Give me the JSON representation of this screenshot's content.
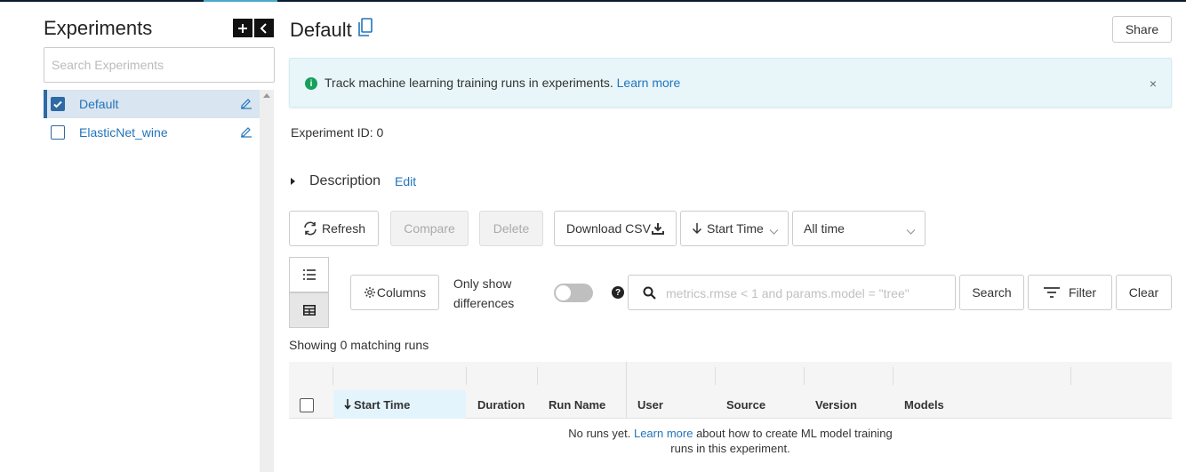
{
  "sidebar": {
    "title": "Experiments",
    "search_placeholder": "Search Experiments",
    "items": [
      {
        "name": "Default",
        "selected": true
      },
      {
        "name": "ElasticNet_wine",
        "selected": false
      }
    ]
  },
  "header": {
    "title": "Default",
    "share_label": "Share"
  },
  "banner": {
    "message": "Track machine learning training runs in experiments.",
    "link": "Learn more",
    "close": "×"
  },
  "experiment": {
    "id_label": "Experiment ID:",
    "id_value": "0"
  },
  "description": {
    "label": "Description",
    "edit_label": "Edit"
  },
  "toolbar": {
    "refresh": "Refresh",
    "compare": "Compare",
    "delete": "Delete",
    "download": "Download CSV",
    "sort_label": "Start Time",
    "time_filter": "All time"
  },
  "controls": {
    "columns": "Columns",
    "only_show_line1": "Only show",
    "only_show_line2": "differences",
    "search_placeholder": "metrics.rmse < 1 and params.model = \"tree\"",
    "search_button": "Search",
    "filter_button": "Filter",
    "clear_button": "Clear"
  },
  "runs": {
    "showing": "Showing 0 matching runs",
    "columns": [
      "Start Time",
      "Duration",
      "Run Name",
      "User",
      "Source",
      "Version",
      "Models"
    ],
    "empty_prefix": "No runs yet.",
    "empty_link": "Learn more",
    "empty_line1_suffix": "about how to create ML model training",
    "empty_line2": "runs in this experiment."
  },
  "colors": {
    "accent": "#2374bb",
    "selected_bg": "#d9e5f0",
    "banner_bg": "#e8f6fa",
    "info_green": "#16a05a"
  }
}
